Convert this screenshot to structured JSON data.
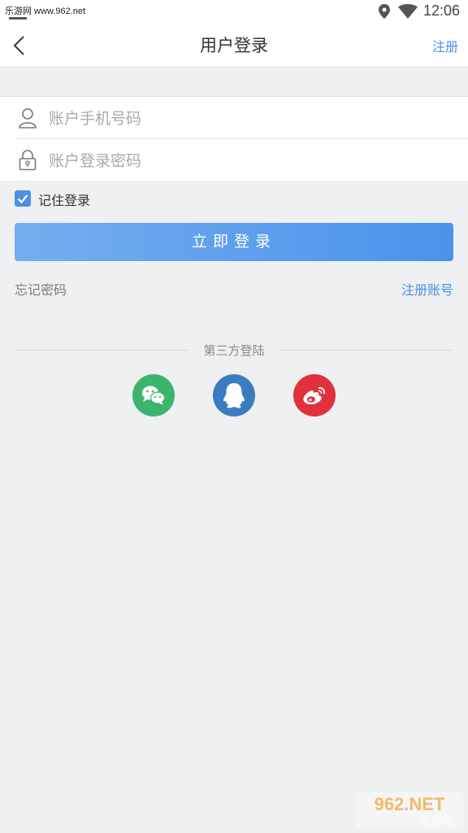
{
  "status_bar": {
    "watermark": "乐游网 www.962.net",
    "time": "12:06",
    "icons": [
      "location-icon",
      "wifi-icon"
    ]
  },
  "nav": {
    "back_icon": "chevron-left-icon",
    "title": "用户登录",
    "register": "注册"
  },
  "form": {
    "phone_placeholder": "账户手机号码",
    "phone_value": "",
    "password_placeholder": "账户登录密码",
    "password_value": ""
  },
  "remember": {
    "label": "记住登录",
    "checked": true
  },
  "login_button": "立即登录",
  "links": {
    "forgot": "忘记密码",
    "register_account": "注册账号"
  },
  "third_party": {
    "label": "第三方登陆",
    "providers": [
      "wechat-icon",
      "qq-icon",
      "weibo-icon"
    ]
  },
  "bottom_watermark": {
    "top": "962.NET",
    "bottom": "乐游网"
  },
  "colors": {
    "accent": "#4c8fe3",
    "wechat": "#3cb46e",
    "qq": "#3a7cc0",
    "weibo": "#e0313c",
    "background": "#eff0f2"
  }
}
